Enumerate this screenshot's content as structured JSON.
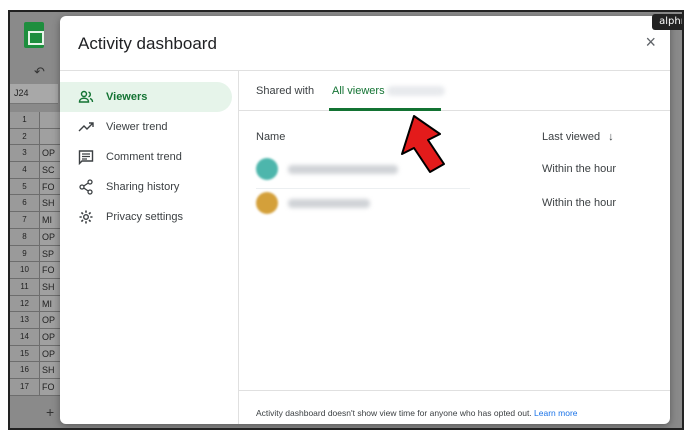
{
  "watermark": "alphr",
  "sheet": {
    "cell_ref": "J24",
    "rows": [
      {
        "num": "1",
        "cell": ""
      },
      {
        "num": "2",
        "cell": ""
      },
      {
        "num": "3",
        "cell": "OP"
      },
      {
        "num": "4",
        "cell": "SC"
      },
      {
        "num": "5",
        "cell": "FO"
      },
      {
        "num": "6",
        "cell": "SH"
      },
      {
        "num": "7",
        "cell": "MI"
      },
      {
        "num": "8",
        "cell": "OP"
      },
      {
        "num": "9",
        "cell": "SP"
      },
      {
        "num": "10",
        "cell": "FO"
      },
      {
        "num": "11",
        "cell": "SH"
      },
      {
        "num": "12",
        "cell": "MI"
      },
      {
        "num": "13",
        "cell": "OP"
      },
      {
        "num": "14",
        "cell": "OP"
      },
      {
        "num": "15",
        "cell": "OP"
      },
      {
        "num": "16",
        "cell": "SH"
      },
      {
        "num": "17",
        "cell": "FO"
      }
    ],
    "add_sheet": "+"
  },
  "modal": {
    "title": "Activity dashboard",
    "close_icon": "×",
    "nav": [
      {
        "label": "Viewers",
        "icon": "people-icon",
        "active": true
      },
      {
        "label": "Viewer trend",
        "icon": "trend-icon",
        "active": false
      },
      {
        "label": "Comment trend",
        "icon": "comment-icon",
        "active": false
      },
      {
        "label": "Sharing history",
        "icon": "share-icon",
        "active": false
      },
      {
        "label": "Privacy settings",
        "icon": "gear-icon",
        "active": false
      }
    ],
    "tabs": [
      {
        "label": "Shared with",
        "active": false
      },
      {
        "label": "All viewers",
        "active": true
      }
    ],
    "columns": {
      "name": "Name",
      "last_viewed": "Last viewed",
      "sort_icon": "↓"
    },
    "viewers": [
      {
        "last_viewed": "Within the hour",
        "avatar_color": "#4db6ac"
      },
      {
        "last_viewed": "Within the hour",
        "avatar_color": "#d4a03a"
      }
    ],
    "footer": {
      "text": "Activity dashboard doesn't show view time for anyone who has opted out.",
      "link": "Learn more"
    }
  },
  "colors": {
    "accent": "#137333",
    "link": "#1a73e8",
    "arrow": "#e31b1b"
  }
}
